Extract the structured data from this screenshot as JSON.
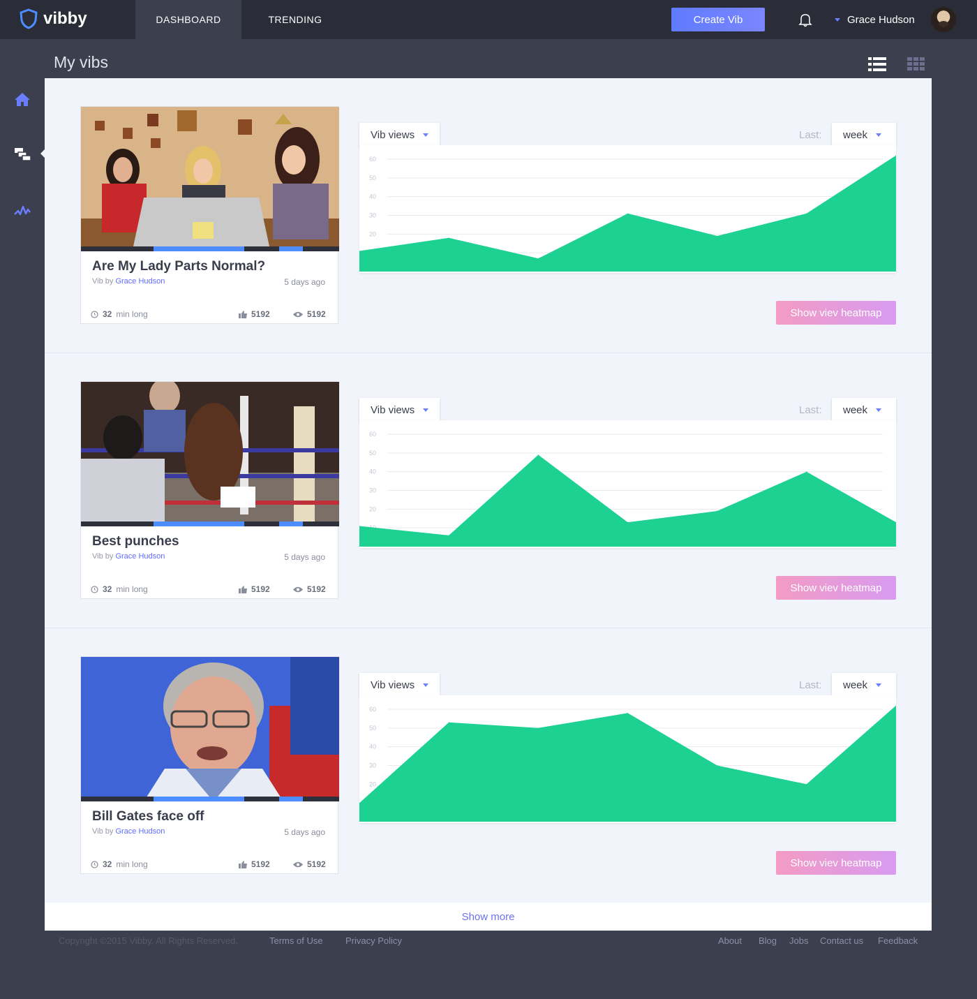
{
  "app": {
    "name": "vibby",
    "nav": [
      {
        "label": "DASHBOARD",
        "active": true
      },
      {
        "label": "TRENDING",
        "active": false
      }
    ],
    "create_button": "Create Vib",
    "user_name": "Grace Hudson"
  },
  "sidebar": [
    {
      "icon": "home-icon"
    },
    {
      "icon": "my-vibs-icon",
      "active": true
    },
    {
      "icon": "activity-icon"
    }
  ],
  "page": {
    "title": "My vibs",
    "view_modes": [
      "list-view-icon",
      "grid-view-icon"
    ],
    "show_more": "Show more"
  },
  "vibs": [
    {
      "title": "Are My Lady Parts Normal?",
      "vib_by": "Vib by",
      "author": "Grace Hudson",
      "ago": "5 days ago",
      "length_value": "32",
      "length_unit": "min long",
      "likes": "5192",
      "views": "5192",
      "metric": "Vib views",
      "last_label": "Last:",
      "period": "week",
      "heatmap_button": "Show viev heatmap"
    },
    {
      "title": "Best punches",
      "vib_by": "Vib by",
      "author": "Grace Hudson",
      "ago": "5 days ago",
      "length_value": "32",
      "length_unit": "min long",
      "likes": "5192",
      "views": "5192",
      "metric": "Vib views",
      "last_label": "Last:",
      "period": "week",
      "heatmap_button": "Show viev heatmap"
    },
    {
      "title": "Bill Gates face off",
      "vib_by": "Vib by",
      "author": "Grace Hudson",
      "ago": "5 days ago",
      "length_value": "32",
      "length_unit": "min long",
      "likes": "5192",
      "views": "5192",
      "metric": "Vib views",
      "last_label": "Last:",
      "period": "week",
      "heatmap_button": "Show viev heatmap"
    }
  ],
  "chart_data": [
    {
      "type": "area",
      "ylim": [
        0,
        60
      ],
      "yticks": [
        "10",
        "20",
        "30",
        "40",
        "50",
        "60"
      ],
      "values": [
        11,
        18,
        7,
        31,
        19,
        31,
        62
      ],
      "color": "#1dd193"
    },
    {
      "type": "area",
      "ylim": [
        0,
        60
      ],
      "yticks": [
        "10",
        "20",
        "30",
        "40",
        "50",
        "60"
      ],
      "values": [
        11,
        6,
        49,
        13,
        19,
        40,
        13
      ],
      "color": "#1dd193"
    },
    {
      "type": "area",
      "ylim": [
        0,
        60
      ],
      "yticks": [
        "10",
        "20",
        "30",
        "40",
        "50",
        "60"
      ],
      "values": [
        10,
        53,
        50,
        58,
        30,
        20,
        62
      ],
      "color": "#1dd193"
    }
  ],
  "footer": {
    "copyright": "Copyright ©2015 Vibby. All Rights Reserved.",
    "left_links": [
      "Terms of Use",
      "Privacy Policy"
    ],
    "right_links": [
      "About",
      "Blog",
      "Jobs",
      "Contact us",
      "Feedback"
    ]
  },
  "colors": {
    "accent": "#5e6cff",
    "chart_fill": "#1dd193",
    "heatmap_button": "#f39bc4",
    "topbar": "#2a2c37",
    "background": "#3c3f4d",
    "panel": "#f2f4fc"
  }
}
